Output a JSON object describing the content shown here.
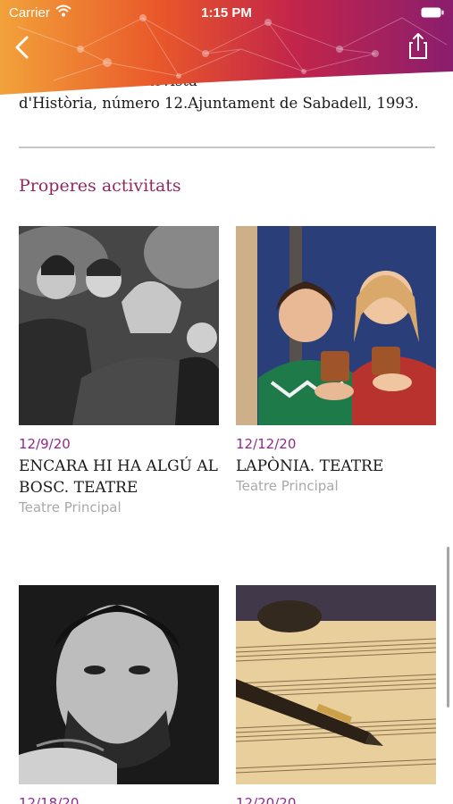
{
  "status_bar": {
    "carrier": "Carrier",
    "time": "1:15 PM"
  },
  "reference": {
    "line1": "... TARRAGONA Revista",
    "line2": "d'Història, número 12.Ajuntament de Sabadell, 1993."
  },
  "section_title": "Properes activitats",
  "activities": [
    {
      "date": "12/9/20",
      "title": "ENCARA HI HA ALGÚ AL BOSC. TEATRE",
      "venue": "Teatre Principal",
      "image": "black-and-white group portrait of four women"
    },
    {
      "date": "12/12/20",
      "title": "LAPÒNIA. TEATRE",
      "venue": "Teatre Principal",
      "image": "two women toasting in christmas sweaters"
    },
    {
      "date": "12/18/20",
      "title": "",
      "venue": "",
      "image": "black-and-white portrait of a man"
    },
    {
      "date": "12/20/20",
      "title": "",
      "venue": "",
      "image": "sheet music with a fountain pen"
    }
  ],
  "colors": {
    "accent": "#8e2a5e",
    "date": "#8e2a8a",
    "venue": "#a9a9a9",
    "header_start": "#f28b1e",
    "header_end": "#8a1e6e"
  },
  "icons": {
    "back": "chevron-left-icon",
    "share": "share-icon"
  }
}
